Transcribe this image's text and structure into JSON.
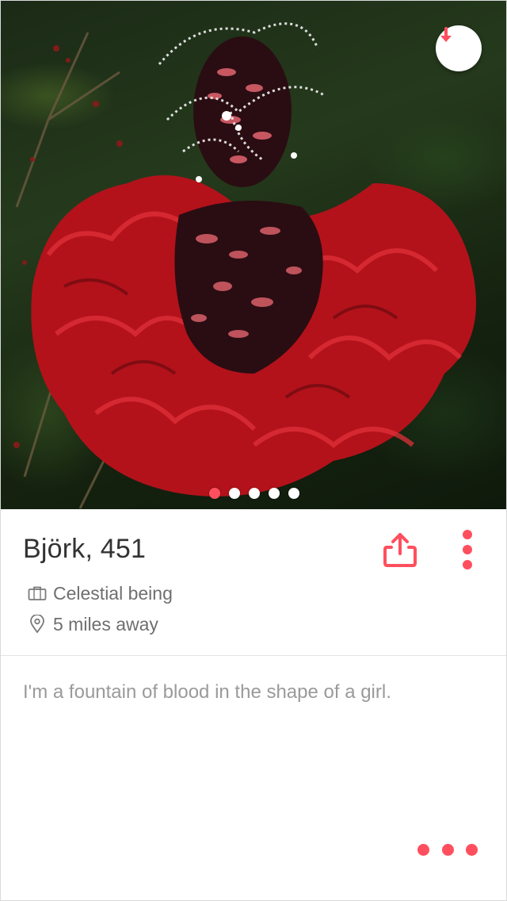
{
  "colors": {
    "accent": "#ff4f5e",
    "text_primary": "#333333",
    "text_secondary": "#6f6f6f",
    "text_bio": "#9a9a9a"
  },
  "photo": {
    "pager": {
      "count": 5,
      "active_index": 0
    },
    "download_icon": "arrow-down-icon"
  },
  "profile": {
    "name_age": "Björk, 451",
    "job": "Celestial being",
    "job_icon": "briefcase-icon",
    "distance": "5 miles away",
    "distance_icon": "location-pin-icon",
    "bio": "I'm a fountain of blood in the shape of a girl."
  },
  "actions": {
    "share_icon": "share-icon",
    "more_icon": "more-vertical-icon",
    "bottom_more_icon": "more-horizontal-icon"
  }
}
